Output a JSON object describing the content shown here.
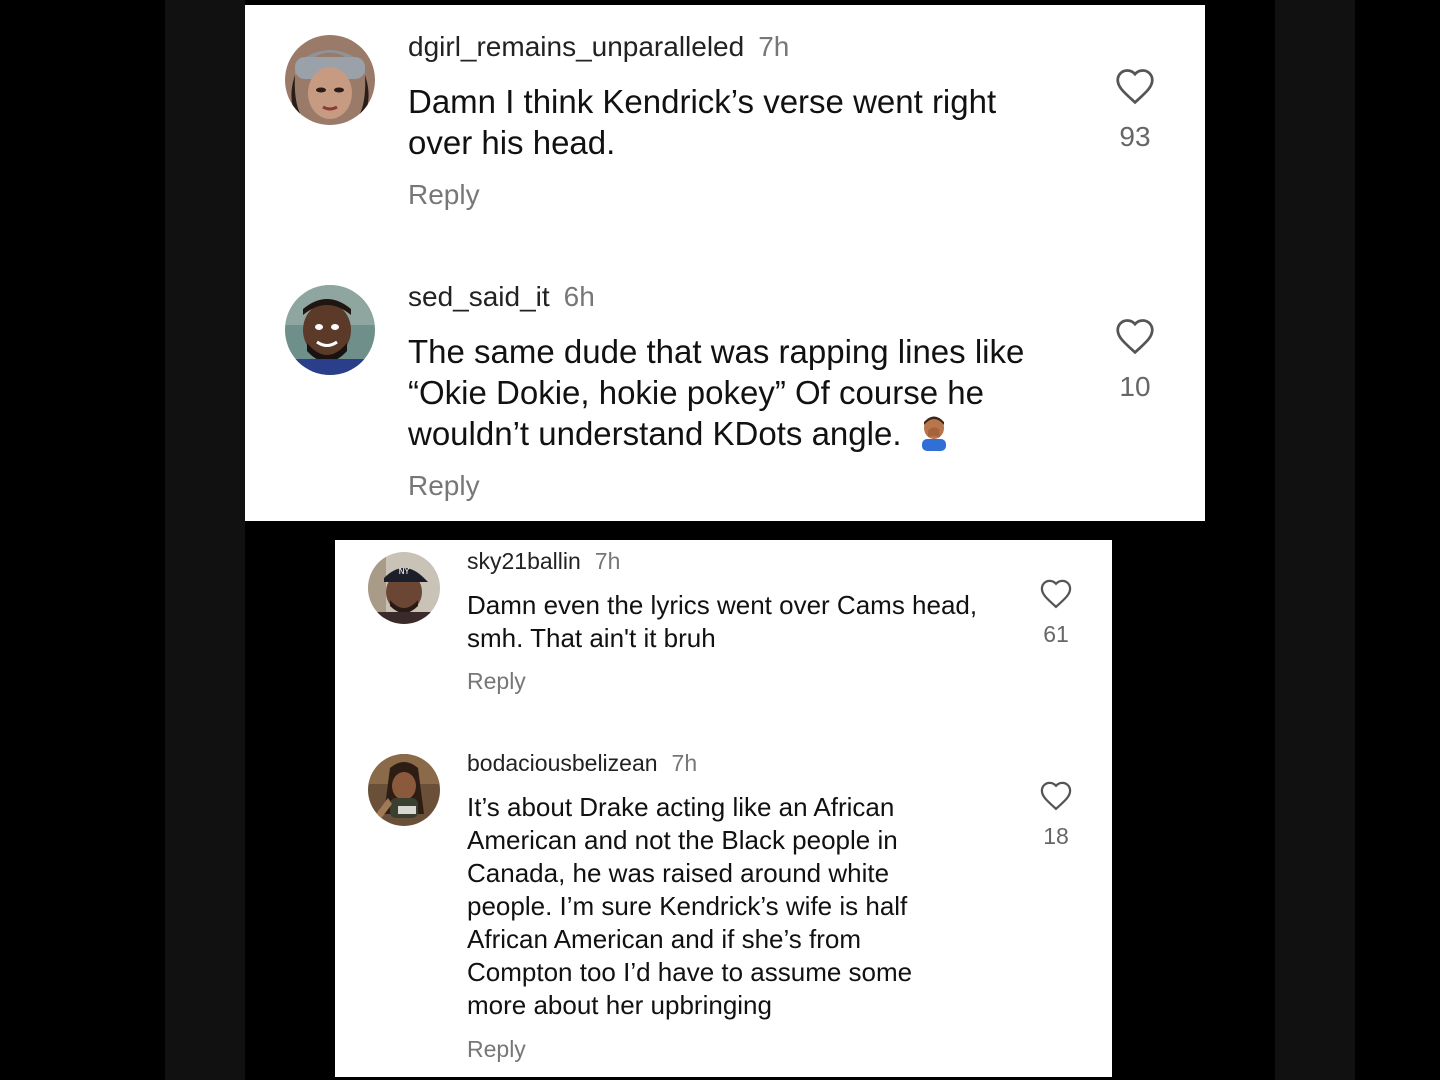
{
  "panels": [
    {
      "comments": [
        {
          "username": "dgirl_remains_unparalleled",
          "time": "7h",
          "text": "Damn I think Kendrick’s verse went right over his head.",
          "reply_label": "Reply",
          "likes": "93",
          "avatar_icon": "avatar-woman-gray-beanie"
        },
        {
          "username": "sed_said_it",
          "time": "6h",
          "text": "The same dude that was rapping lines like “Okie Dokie, hokie pokey”  Of course he wouldn’t understand KDots angle.",
          "emoji": "face-palm-emoji",
          "reply_label": "Reply",
          "likes": "10",
          "avatar_icon": "avatar-man-smiling"
        }
      ]
    },
    {
      "comments": [
        {
          "username": "sky21ballin",
          "time": "7h",
          "text": "Damn even the lyrics went over Cams head, smh. That ain't it bruh",
          "reply_label": "Reply",
          "likes": "61",
          "avatar_icon": "avatar-man-cap"
        },
        {
          "username": "bodaciousbelizean",
          "time": "7h",
          "text": "It’s about Drake acting like an African American and not the Black people in Canada, he was raised around white people. I’m sure Kendrick’s wife is half African American and if she’s from Compton too I’d have to assume some more about her upbringing",
          "reply_label": "Reply",
          "likes": "18",
          "avatar_icon": "avatar-woman-braids"
        }
      ]
    }
  ],
  "colors": {
    "background": "#000000",
    "panel": "#ffffff",
    "text": "#111111",
    "muted": "#777777",
    "heart_stroke": "#555555"
  },
  "icons": {
    "like": "heart-outline-icon"
  }
}
